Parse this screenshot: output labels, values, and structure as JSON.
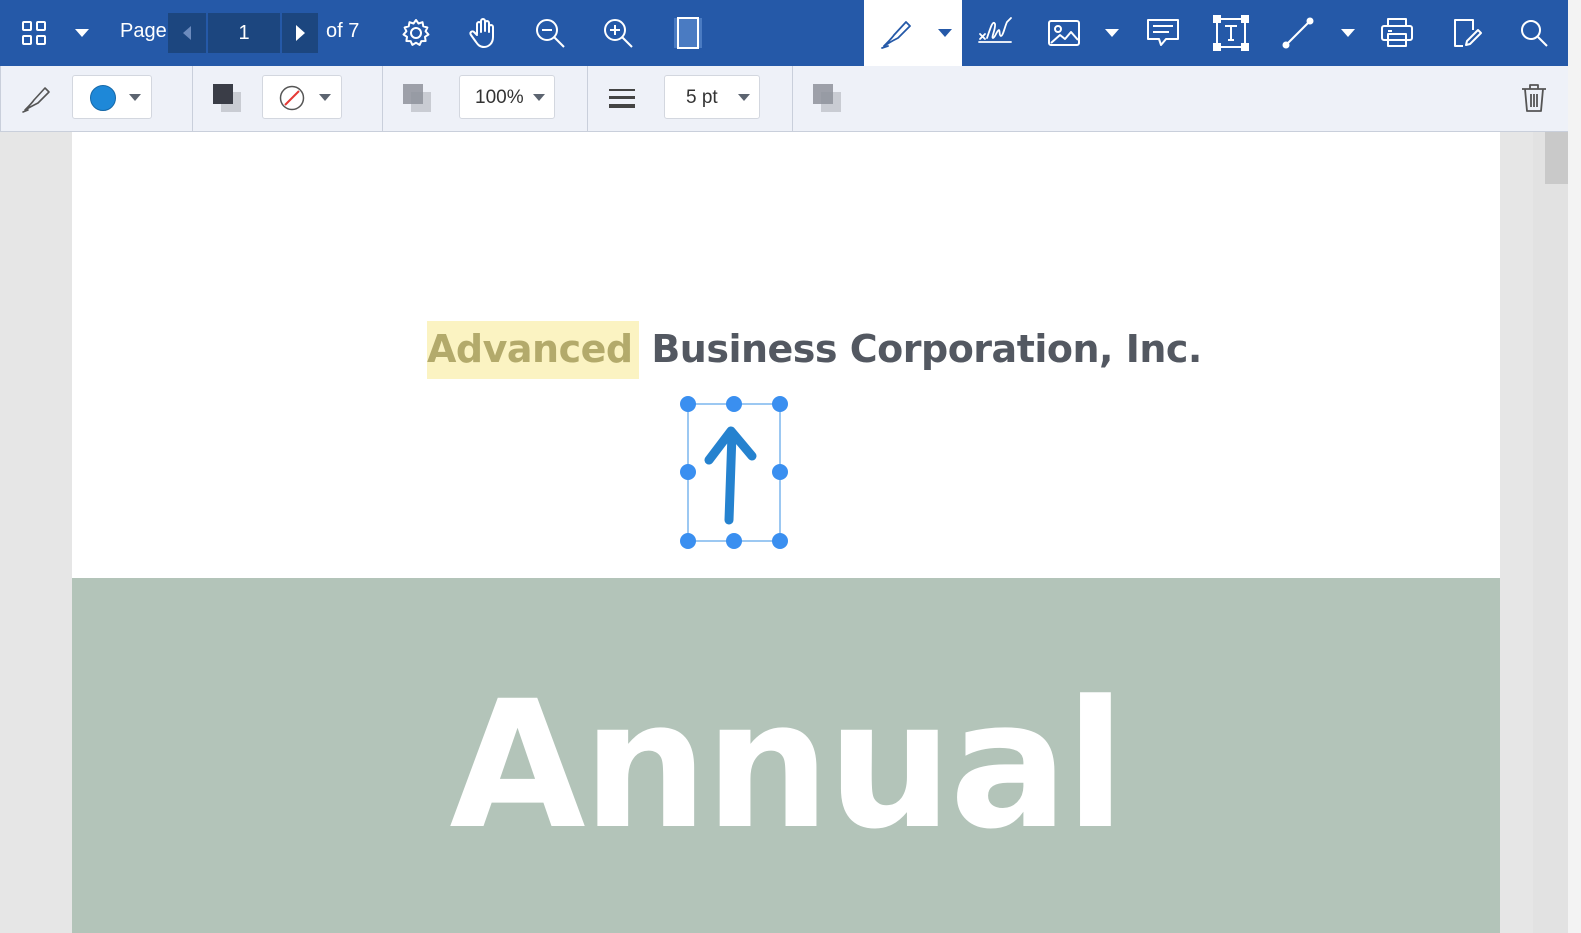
{
  "toolbar": {
    "page_label": "Page",
    "current_page": "1",
    "total_pages": "of 7",
    "icons": [
      "grid-icon",
      "dropdown-caret",
      "settings-icon",
      "hand-icon",
      "zoom-out-icon",
      "zoom-in-icon",
      "page-view-icon",
      "ink-pen-icon",
      "signature-icon",
      "image-icon",
      "comment-icon",
      "text-box-icon",
      "line-icon",
      "print-icon",
      "edit-icon",
      "search-icon"
    ]
  },
  "properties": {
    "stroke_color": "#1e88d8",
    "opacity": "100%",
    "thickness": "5 pt"
  },
  "document": {
    "title_highlighted": "Advanced",
    "title_rest": "Business Corporation, Inc.",
    "banner_text": "Annual",
    "banner_color": "#b3c4b9"
  },
  "colors": {
    "toolbar_bg": "#2559a8",
    "pager_bg": "#1c467f",
    "annotation_blue": "#2582cf",
    "handle_blue": "#3a8ff0"
  }
}
